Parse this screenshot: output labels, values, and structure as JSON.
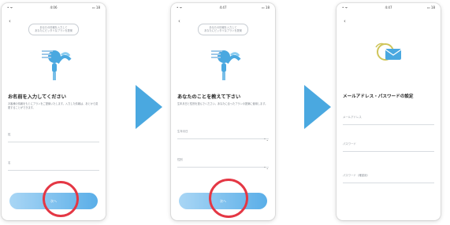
{
  "colors": {
    "accent": "#5aaee8",
    "arrow": "#4aa8e0",
    "highlight": "#e43744"
  },
  "screens": [
    {
      "status": {
        "left": "• ᯤ",
        "time": "4:06",
        "right": "▭ 18"
      },
      "back": "‹",
      "bubble": "あなたの情報を入力して\nあなたにピッタリなプランを提案",
      "title": "お名前を入力してください",
      "desc": "お客様の情報をもとにプランをご提案いたします。入力した情報は、あとから変更することができます。",
      "fields": [
        {
          "label": "姓"
        },
        {
          "label": "名"
        }
      ],
      "button": "次へ"
    },
    {
      "status": {
        "left": "• ᯤ",
        "time": "4:47",
        "right": "▭ 18"
      },
      "back": "‹",
      "bubble": "あなたの情報を入力して\nあなたにピッタリなプランを提案",
      "title": "あなたのことを教えて下さい",
      "desc": "生年月日と性別を選んでください。あなたに合ったプランの提案に使用します。",
      "fields": [
        {
          "label": "生年月日",
          "chevron": "⌃⌄"
        },
        {
          "label": "性別",
          "chevron": "⌃⌄"
        }
      ],
      "button": "次へ"
    },
    {
      "status": {
        "left": "• ᯤ",
        "time": "4:47",
        "right": "▭ 18"
      },
      "back": "‹",
      "title": "メールアドレス・パスワードの設定",
      "fields": [
        {
          "label": "メールアドレス"
        },
        {
          "label": "パスワード"
        },
        {
          "label": "パスワード（確認用）"
        }
      ]
    }
  ]
}
